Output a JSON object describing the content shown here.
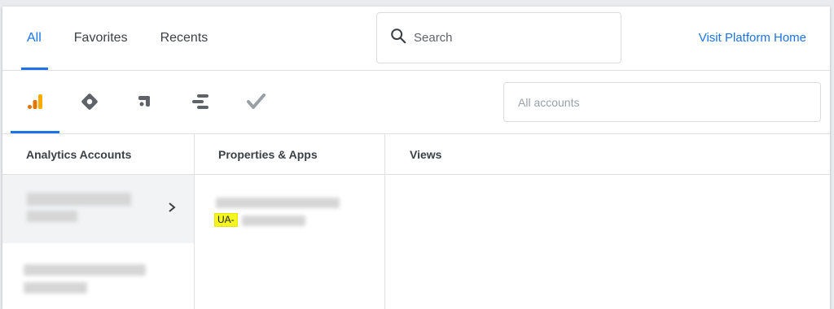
{
  "tabs": [
    {
      "label": "All",
      "active": true
    },
    {
      "label": "Favorites",
      "active": false
    },
    {
      "label": "Recents",
      "active": false
    }
  ],
  "search": {
    "placeholder": "Search"
  },
  "visit_link": "Visit Platform Home",
  "products": [
    {
      "icon": "analytics-icon",
      "color": "#f9ab00",
      "active": true
    },
    {
      "icon": "tag-manager-icon",
      "color": "#5f6368",
      "active": false
    },
    {
      "icon": "optimize-icon",
      "color": "#5f6368",
      "active": false
    },
    {
      "icon": "data-studio-icon",
      "color": "#5f6368",
      "active": false
    },
    {
      "icon": "surveys-icon",
      "color": "#9aa0a6",
      "active": false
    }
  ],
  "accounts_filter": {
    "placeholder": "All accounts"
  },
  "columns": {
    "accounts": "Analytics Accounts",
    "properties": "Properties & Apps",
    "views": "Views"
  },
  "property": {
    "id_prefix": "UA-"
  },
  "colors": {
    "accent": "#1a73e8",
    "highlight": "#f5f51f",
    "analytics": "#f9ab00"
  }
}
